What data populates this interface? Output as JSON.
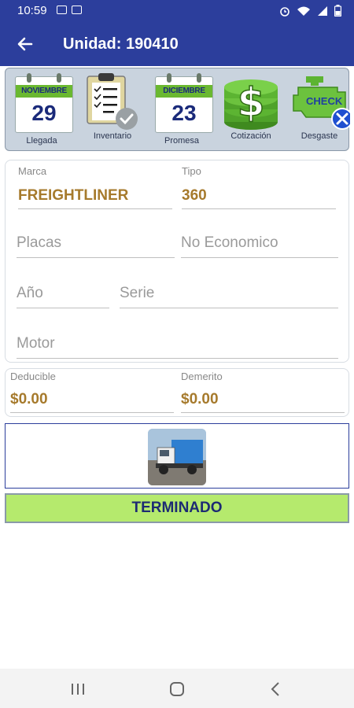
{
  "status_bar": {
    "time": "10:59"
  },
  "app_bar": {
    "title": "Unidad: 190410"
  },
  "icon_strip": {
    "llegada": {
      "month": "NOVIEMBRE",
      "day": "29",
      "label": "Llegada"
    },
    "inventario": {
      "label": "Inventario"
    },
    "promesa": {
      "month": "DICIEMBRE",
      "day": "23",
      "label": "Promesa"
    },
    "cotizacion": {
      "label": "Cotización"
    },
    "desgaste": {
      "badge": "CHECK",
      "label": "Desgaste"
    }
  },
  "vehicle": {
    "marca_label": "Marca",
    "marca": "FREIGHTLINER",
    "tipo_label": "Tipo",
    "tipo": "360",
    "placas_hint": "Placas",
    "no_economico_hint": "No Economico",
    "anio_hint": "Año",
    "serie_hint": "Serie",
    "motor_hint": "Motor"
  },
  "costs": {
    "deducible_label": "Deducible",
    "deducible": "$0.00",
    "demerito_label": "Demerito",
    "demerito": "$0.00"
  },
  "status_button": "TERMINADO",
  "icons": [
    "back-arrow-icon",
    "calendar-icon",
    "clipboard-check-icon",
    "dollar-coins-icon",
    "check-engine-icon",
    "truck-photo",
    "recents-icon",
    "home-icon",
    "back-icon"
  ],
  "colors": {
    "primary": "#2c3e9c",
    "accent_value": "#a67a2c",
    "status_green": "#b5ea6d"
  }
}
